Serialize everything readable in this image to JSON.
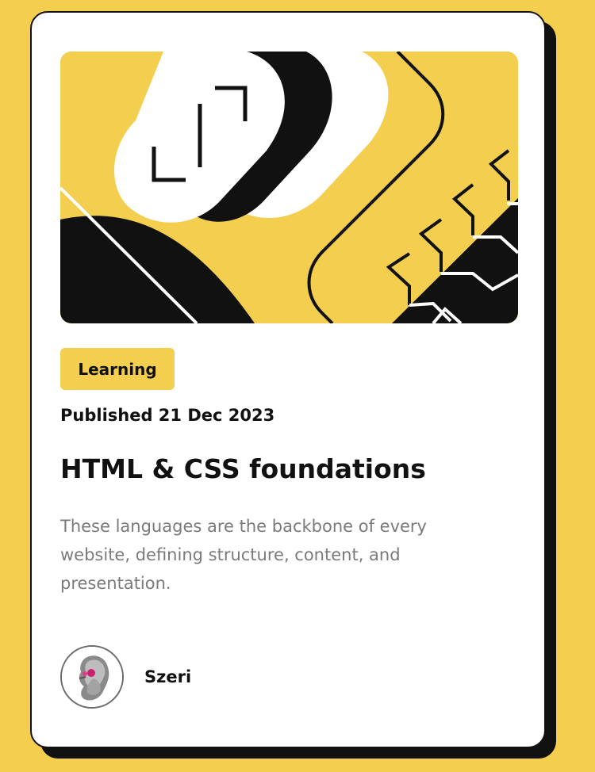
{
  "card": {
    "tag": "Learning",
    "published": "Published 21 Dec 2023",
    "title": "HTML & CSS foundations",
    "description": "These languages are the backbone of every website, defining structure, content, and presentation.",
    "author": {
      "name": "Szeri"
    }
  },
  "colors": {
    "background": "#F4CE4E",
    "card": "#FFFFFF",
    "ink": "#111111",
    "muted_text": "#7A7A7A"
  },
  "icons": {
    "hero": "code-illustration",
    "avatar": "author-avatar"
  }
}
